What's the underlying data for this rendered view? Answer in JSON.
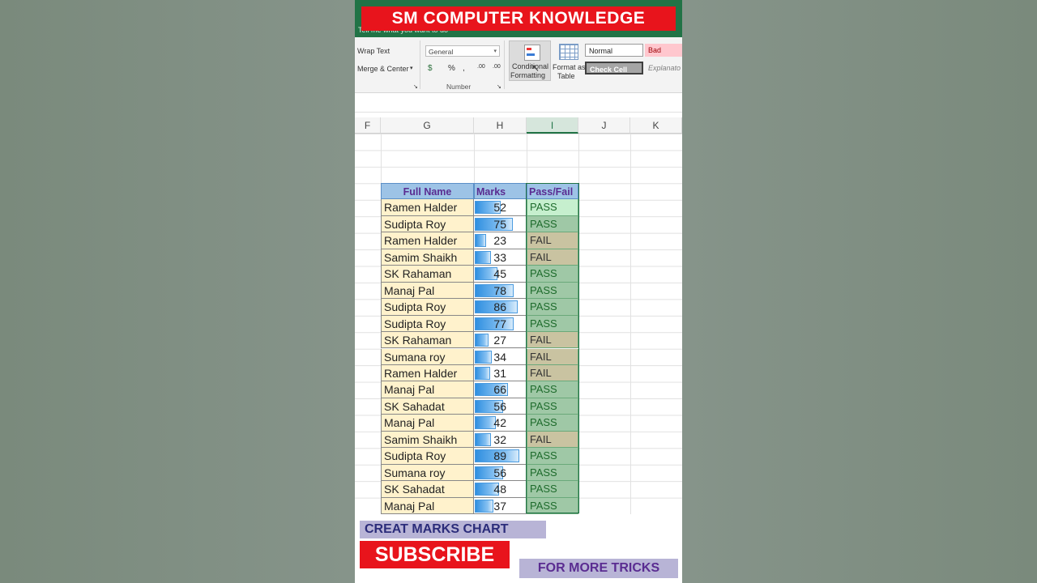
{
  "banner": {
    "title": "SM COMPUTER KNOWLEDGE"
  },
  "ribbon": {
    "tell_me": "Tell me what you want to do",
    "wrap_text": "Wrap Text",
    "merge_center": "Merge & Center",
    "number_format": "General",
    "currency": "$",
    "percent": "%",
    "comma": ",",
    "inc_decimal": ".00",
    "dec_decimal": ".00",
    "number_group": "Number",
    "conditional_formatting_1": "Conditional",
    "conditional_formatting_2": "Formatting",
    "format_table_1": "Format as",
    "format_table_2": "Table",
    "style_normal": "Normal",
    "style_bad": "Bad",
    "style_check_cell": "Check Cell",
    "style_explanatory": "Explanato"
  },
  "columns": [
    "F",
    "G",
    "H",
    "I",
    "J",
    "K"
  ],
  "table": {
    "headers": {
      "name": "Full Name",
      "marks": "Marks",
      "result": "Pass/Fail"
    },
    "rows": [
      {
        "name": "Ramen Halder",
        "marks": 52,
        "result": "PASS"
      },
      {
        "name": "Sudipta Roy",
        "marks": 75,
        "result": "PASS"
      },
      {
        "name": "Ramen Halder",
        "marks": 23,
        "result": "FAIL"
      },
      {
        "name": "Samim Shaikh",
        "marks": 33,
        "result": "FAIL"
      },
      {
        "name": "SK Rahaman",
        "marks": 45,
        "result": "PASS"
      },
      {
        "name": "Manaj Pal",
        "marks": 78,
        "result": "PASS"
      },
      {
        "name": "Sudipta Roy",
        "marks": 86,
        "result": "PASS"
      },
      {
        "name": "Sudipta Roy",
        "marks": 77,
        "result": "PASS"
      },
      {
        "name": "SK Rahaman",
        "marks": 27,
        "result": "FAIL"
      },
      {
        "name": "Sumana roy",
        "marks": 34,
        "result": "FAIL"
      },
      {
        "name": "Ramen Halder",
        "marks": 31,
        "result": "FAIL"
      },
      {
        "name": "Manaj Pal",
        "marks": 66,
        "result": "PASS"
      },
      {
        "name": "SK Sahadat",
        "marks": 56,
        "result": "PASS"
      },
      {
        "name": "Manaj Pal",
        "marks": 42,
        "result": "PASS"
      },
      {
        "name": "Samim Shaikh",
        "marks": 32,
        "result": "FAIL"
      },
      {
        "name": "Sudipta Roy",
        "marks": 89,
        "result": "PASS"
      },
      {
        "name": "Sumana roy",
        "marks": 56,
        "result": "PASS"
      },
      {
        "name": "SK Sahadat",
        "marks": 48,
        "result": "PASS"
      },
      {
        "name": "Manaj Pal",
        "marks": 37,
        "result": "PASS"
      }
    ]
  },
  "overlay": {
    "promo": "CREAT MARKS CHART",
    "subscribe": "SUBSCRIBE",
    "tricks": "FOR MORE TRICKS"
  },
  "colors": {
    "excel_green": "#217346",
    "banner_red": "#e8141c",
    "name_fill": "#fff2cc",
    "pass_fill": "#9fc8a6",
    "fail_fill": "#c9c3a1"
  }
}
